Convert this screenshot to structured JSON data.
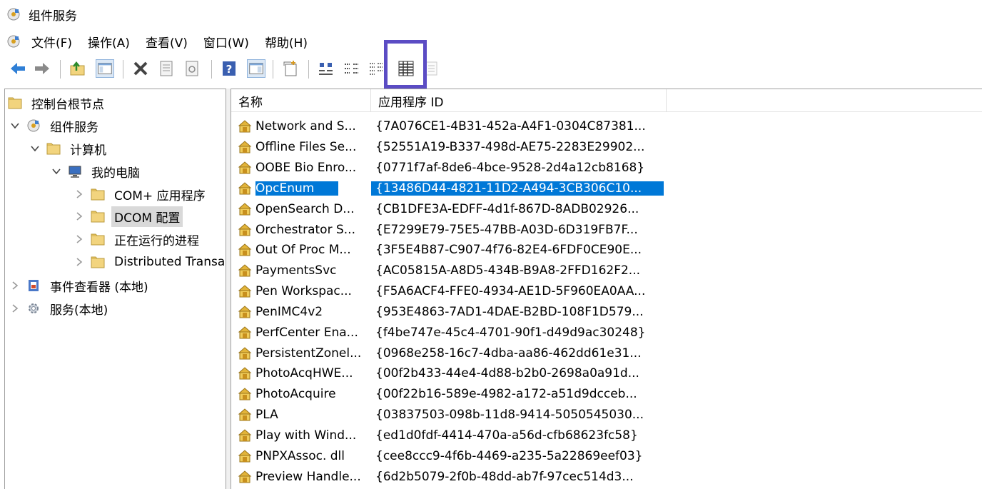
{
  "window": {
    "title": "组件服务"
  },
  "menu": [
    "文件(F)",
    "操作(A)",
    "查看(V)",
    "窗口(W)",
    "帮助(H)"
  ],
  "toolbar": [
    "back-arrow-icon",
    "forward-arrow-icon",
    "folder-up-icon",
    "show-hide-console-tree-icon",
    "delete-icon",
    "properties-icon",
    "refresh-icon",
    "help-icon",
    "action-pane-icon",
    "new-window-icon",
    "large-icons-view-icon",
    "small-icons-view-icon",
    "list-view-icon",
    "detail-view-icon",
    "status-view-icon"
  ],
  "tree": [
    {
      "label": "控制台根节点",
      "expander": "none",
      "icon": "folder"
    },
    {
      "label": "组件服务",
      "expander": "expanded",
      "icon": "component"
    },
    {
      "label": "计算机",
      "expander": "expanded",
      "icon": "folder"
    },
    {
      "label": "我的电脑",
      "expander": "expanded",
      "icon": "computer"
    },
    {
      "label": "COM+ 应用程序",
      "expander": "collapsed",
      "icon": "folder"
    },
    {
      "label": "DCOM 配置",
      "expander": "collapsed",
      "icon": "folder",
      "selected": true
    },
    {
      "label": "正在运行的进程",
      "expander": "collapsed",
      "icon": "folder"
    },
    {
      "label": "Distributed Transaction Coordinator",
      "expander": "collapsed",
      "icon": "folder"
    },
    {
      "label": "事件查看器 (本地)",
      "expander": "collapsed",
      "icon": "eventviewer"
    },
    {
      "label": "服务(本地)",
      "expander": "collapsed",
      "icon": "services"
    }
  ],
  "list": {
    "columns": [
      "名称",
      "应用程序 ID"
    ],
    "selected_index": 3,
    "rows": [
      {
        "name": "Network and S...",
        "id": "{7A076CE1-4B31-452a-A4F1-0304C87381..."
      },
      {
        "name": "Offline Files Se...",
        "id": "{52551A19-B337-498d-AE75-2283E29902..."
      },
      {
        "name": "OOBE Bio Enro...",
        "id": "{0771f7af-8de6-4bce-9528-2d4a12cb8168}"
      },
      {
        "name": "OpcEnum",
        "id": "{13486D44-4821-11D2-A494-3CB306C10..."
      },
      {
        "name": "OpenSearch D...",
        "id": "{CB1DFE3A-EDFF-4d1f-867D-8ADB02926..."
      },
      {
        "name": "Orchestrator S...",
        "id": "{E7299E79-75E5-47BB-A03D-6D319FB7F..."
      },
      {
        "name": "Out Of Proc M...",
        "id": "{3F5E4B87-C907-4f76-82E4-6FDF0CE90E..."
      },
      {
        "name": "PaymentsSvc",
        "id": "{AC05815A-A8D5-434B-B9A8-2FFD162F2..."
      },
      {
        "name": "Pen Workspac...",
        "id": "{F5A6ACF4-FFE0-4934-AE1D-5F960EA0AA..."
      },
      {
        "name": "PenIMC4v2",
        "id": "{953E4863-7AD1-4DAE-B2BD-108F1D579..."
      },
      {
        "name": "PerfCenter Ena...",
        "id": "{f4be747e-45c4-4701-90f1-d49d9ac30248}"
      },
      {
        "name": "PersistentZonel...",
        "id": "{0968e258-16c7-4dba-aa86-462dd61e31..."
      },
      {
        "name": "PhotoAcqHWE...",
        "id": "{00f2b433-44e4-4d88-b2b0-2698a0a91d..."
      },
      {
        "name": "PhotoAcquire",
        "id": "{00f22b16-589e-4982-a172-a51d9dcceb..."
      },
      {
        "name": "PLA",
        "id": "{03837503-098b-11d8-9414-5050545030..."
      },
      {
        "name": "Play with Wind...",
        "id": "{ed1d0fdf-4414-470a-a56d-cfb68623fc58}"
      },
      {
        "name": "PNPXAssoc. dll",
        "id": "{cee8ccc9-4f6b-4469-a235-5a22869eef03}"
      },
      {
        "name": "Preview Handle...",
        "id": "{6d2b5079-2f0b-48dd-ab7f-97cec514d3..."
      }
    ]
  },
  "colors": {
    "selection": "#0078d7",
    "highlight_box": "#5b4cc4",
    "folder": "#f2d47e"
  }
}
